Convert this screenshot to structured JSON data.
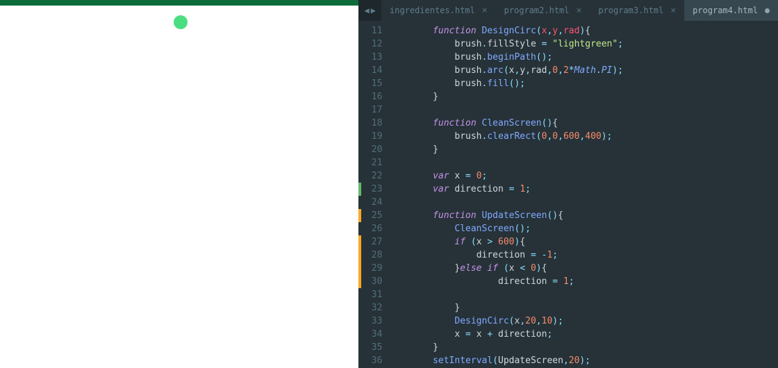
{
  "tabs": [
    {
      "name": "ingredientes.html",
      "active": false,
      "modified": false
    },
    {
      "name": "program2.html",
      "active": false,
      "modified": false
    },
    {
      "name": "program3.html",
      "active": false,
      "modified": false
    },
    {
      "name": "program4.html",
      "active": true,
      "modified": true
    }
  ],
  "nav": {
    "left": "◀",
    "right": "▶"
  },
  "lines": [
    {
      "num": "11",
      "mark": ""
    },
    {
      "num": "12",
      "mark": ""
    },
    {
      "num": "13",
      "mark": ""
    },
    {
      "num": "14",
      "mark": ""
    },
    {
      "num": "15",
      "mark": ""
    },
    {
      "num": "16",
      "mark": ""
    },
    {
      "num": "17",
      "mark": ""
    },
    {
      "num": "18",
      "mark": ""
    },
    {
      "num": "19",
      "mark": ""
    },
    {
      "num": "20",
      "mark": ""
    },
    {
      "num": "21",
      "mark": ""
    },
    {
      "num": "22",
      "mark": ""
    },
    {
      "num": "23",
      "mark": "green"
    },
    {
      "num": "24",
      "mark": ""
    },
    {
      "num": "25",
      "mark": "yellow"
    },
    {
      "num": "26",
      "mark": ""
    },
    {
      "num": "27",
      "mark": "yellow"
    },
    {
      "num": "28",
      "mark": "yellow"
    },
    {
      "num": "29",
      "mark": "yellow"
    },
    {
      "num": "30",
      "mark": "yellow"
    },
    {
      "num": "31",
      "mark": ""
    },
    {
      "num": "32",
      "mark": ""
    },
    {
      "num": "33",
      "mark": ""
    },
    {
      "num": "34",
      "mark": ""
    },
    {
      "num": "35",
      "mark": ""
    },
    {
      "num": "36",
      "mark": ""
    }
  ],
  "code": {
    "t11_fn": "function",
    "t11_name": "DesignCirc",
    "t11_p1": "x",
    "t11_p2": "y",
    "t11_p3": "rad",
    "t12_obj": "brush",
    "t12_prop": "fillStyle",
    "t12_str": "\"lightgreen\"",
    "t13_obj": "brush",
    "t13_fn": "beginPath",
    "t14_obj": "brush",
    "t14_fn": "arc",
    "t14_v1": "x",
    "t14_v2": "y",
    "t14_v3": "rad",
    "t14_n1": "0",
    "t14_n2": "2",
    "t14_mathobj": "Math",
    "t14_mathprop": "PI",
    "t15_obj": "brush",
    "t15_fn": "fill",
    "t18_fn": "function",
    "t18_name": "CleanScreen",
    "t19_obj": "brush",
    "t19_fn": "clearRect",
    "t19_n1": "0",
    "t19_n2": "0",
    "t19_n3": "600",
    "t19_n4": "400",
    "t22_var": "var",
    "t22_name": "x",
    "t22_val": "0",
    "t23_var": "var",
    "t23_name": "direction",
    "t23_val": "1",
    "t25_fn": "function",
    "t25_name": "UpdateScreen",
    "t26_call": "CleanScreen",
    "t27_if": "if",
    "t27_var": "x",
    "t27_op": ">",
    "t27_num": "600",
    "t28_var": "direction",
    "t28_val": "-1",
    "t29_else": "else",
    "t29_if": "if",
    "t29_var": "x",
    "t29_op": "<",
    "t29_num": "0",
    "t30_var": "direction",
    "t30_val": "1",
    "t33_call": "DesignCirc",
    "t33_v1": "x",
    "t33_n1": "20",
    "t33_n2": "10",
    "t34_v1": "x",
    "t34_v2": "x",
    "t34_v3": "direction",
    "t36_call": "setInterval",
    "t36_arg": "UpdateScreen",
    "t36_num": "20"
  }
}
